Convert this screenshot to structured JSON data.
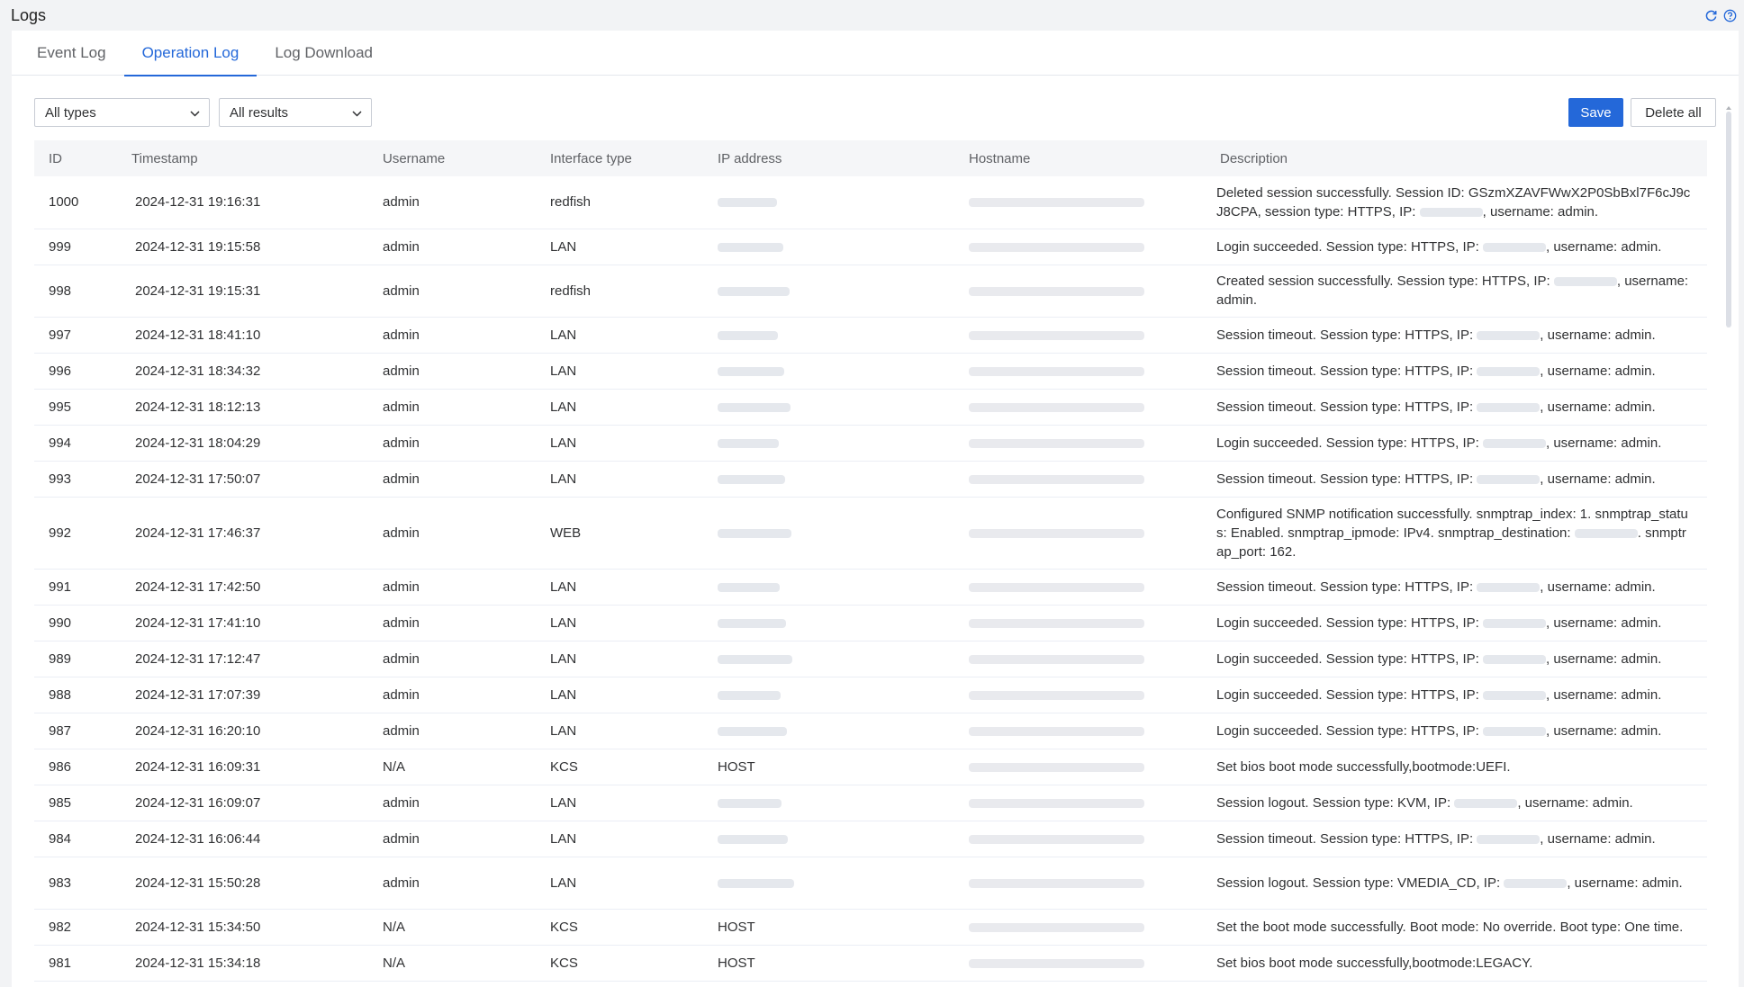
{
  "page": {
    "title": "Logs"
  },
  "icons": {
    "refresh": "refresh-icon",
    "help": "help-icon",
    "chevron": "chevron-down-icon"
  },
  "colors": {
    "accent": "#2468d9",
    "header_bg": "#f5f6f8",
    "border": "#ebeef5"
  },
  "tabs": [
    {
      "label": "Event Log",
      "active": false
    },
    {
      "label": "Operation Log",
      "active": true
    },
    {
      "label": "Log Download",
      "active": false
    }
  ],
  "filters": {
    "types": {
      "value": "All types"
    },
    "results": {
      "value": "All results"
    }
  },
  "actions": {
    "save": "Save",
    "delete_all": "Delete all"
  },
  "table": {
    "columns": [
      "ID",
      "Timestamp",
      "Username",
      "Interface type",
      "IP address",
      "Hostname",
      "Description"
    ],
    "rows": [
      {
        "id": "1000",
        "timestamp": "2024-12-31 19:16:31",
        "username": "admin",
        "interface": "redfish",
        "ip": "",
        "desc": [
          "Deleted session successfully. Session ID: GSzmXZAVFWwX2P0SbBxl7F6cJ9cJ8CPA, session type: HTTPS, IP: ",
          ", username: admin."
        ]
      },
      {
        "id": "999",
        "timestamp": "2024-12-31 19:15:58",
        "username": "admin",
        "interface": "LAN",
        "ip": "",
        "desc": [
          "Login succeeded. Session type: HTTPS, IP: ",
          ", username: admin."
        ]
      },
      {
        "id": "998",
        "timestamp": "2024-12-31 19:15:31",
        "username": "admin",
        "interface": "redfish",
        "ip": "",
        "desc": [
          "Created session successfully. Session type: HTTPS, IP: ",
          ", username: admin."
        ]
      },
      {
        "id": "997",
        "timestamp": "2024-12-31 18:41:10",
        "username": "admin",
        "interface": "LAN",
        "ip": "",
        "desc": [
          "Session timeout. Session type: HTTPS, IP: ",
          ", username: admin."
        ]
      },
      {
        "id": "996",
        "timestamp": "2024-12-31 18:34:32",
        "username": "admin",
        "interface": "LAN",
        "ip": "",
        "desc": [
          "Session timeout. Session type: HTTPS, IP: ",
          ", username: admin."
        ]
      },
      {
        "id": "995",
        "timestamp": "2024-12-31 18:12:13",
        "username": "admin",
        "interface": "LAN",
        "ip": "",
        "desc": [
          "Session timeout. Session type: HTTPS, IP: ",
          ", username: admin."
        ]
      },
      {
        "id": "994",
        "timestamp": "2024-12-31 18:04:29",
        "username": "admin",
        "interface": "LAN",
        "ip": "",
        "desc": [
          "Login succeeded. Session type: HTTPS, IP: ",
          ", username: admin."
        ]
      },
      {
        "id": "993",
        "timestamp": "2024-12-31 17:50:07",
        "username": "admin",
        "interface": "LAN",
        "ip": "",
        "desc": [
          "Session timeout. Session type: HTTPS, IP: ",
          ", username: admin."
        ]
      },
      {
        "id": "992",
        "timestamp": "2024-12-31 17:46:37",
        "username": "admin",
        "interface": "WEB",
        "ip": "",
        "desc": [
          "Configured SNMP notification successfully. snmptrap_index: 1. snmptrap_status: Enabled. snmptrap_ipmode: IPv4. snmptrap_destination: ",
          ". snmptrap_port: 162."
        ]
      },
      {
        "id": "991",
        "timestamp": "2024-12-31 17:42:50",
        "username": "admin",
        "interface": "LAN",
        "ip": "",
        "desc": [
          "Session timeout. Session type: HTTPS, IP: ",
          ", username: admin."
        ]
      },
      {
        "id": "990",
        "timestamp": "2024-12-31 17:41:10",
        "username": "admin",
        "interface": "LAN",
        "ip": "",
        "desc": [
          "Login succeeded. Session type: HTTPS, IP: ",
          ", username: admin."
        ]
      },
      {
        "id": "989",
        "timestamp": "2024-12-31 17:12:47",
        "username": "admin",
        "interface": "LAN",
        "ip": "",
        "desc": [
          "Login succeeded. Session type: HTTPS, IP: ",
          ", username: admin."
        ]
      },
      {
        "id": "988",
        "timestamp": "2024-12-31 17:07:39",
        "username": "admin",
        "interface": "LAN",
        "ip": "",
        "desc": [
          "Login succeeded. Session type: HTTPS, IP: ",
          ", username: admin."
        ]
      },
      {
        "id": "987",
        "timestamp": "2024-12-31 16:20:10",
        "username": "admin",
        "interface": "LAN",
        "ip": "",
        "desc": [
          "Login succeeded. Session type: HTTPS, IP: ",
          ", username: admin."
        ]
      },
      {
        "id": "986",
        "timestamp": "2024-12-31 16:09:31",
        "username": "N/A",
        "interface": "KCS",
        "ip": "HOST",
        "desc": [
          "Set bios boot mode successfully,bootmode:UEFI."
        ]
      },
      {
        "id": "985",
        "timestamp": "2024-12-31 16:09:07",
        "username": "admin",
        "interface": "LAN",
        "ip": "",
        "desc": [
          "Session logout. Session type: KVM, IP: ",
          ", username: admin."
        ]
      },
      {
        "id": "984",
        "timestamp": "2024-12-31 16:06:44",
        "username": "admin",
        "interface": "LAN",
        "ip": "",
        "desc": [
          "Session timeout. Session type: HTTPS, IP: ",
          ", username: admin."
        ]
      },
      {
        "id": "983",
        "timestamp": "2024-12-31 15:50:28",
        "username": "admin",
        "interface": "LAN",
        "ip": "",
        "desc": [
          "Session logout. Session type: VMEDIA_CD, IP: ",
          ", username: admin."
        ]
      },
      {
        "id": "982",
        "timestamp": "2024-12-31 15:34:50",
        "username": "N/A",
        "interface": "KCS",
        "ip": "HOST",
        "desc": [
          "Set the boot mode successfully. Boot mode: No override. Boot type: One time."
        ]
      },
      {
        "id": "981",
        "timestamp": "2024-12-31 15:34:18",
        "username": "N/A",
        "interface": "KCS",
        "ip": "HOST",
        "desc": [
          "Set bios boot mode successfully,bootmode:LEGACY."
        ]
      }
    ]
  }
}
